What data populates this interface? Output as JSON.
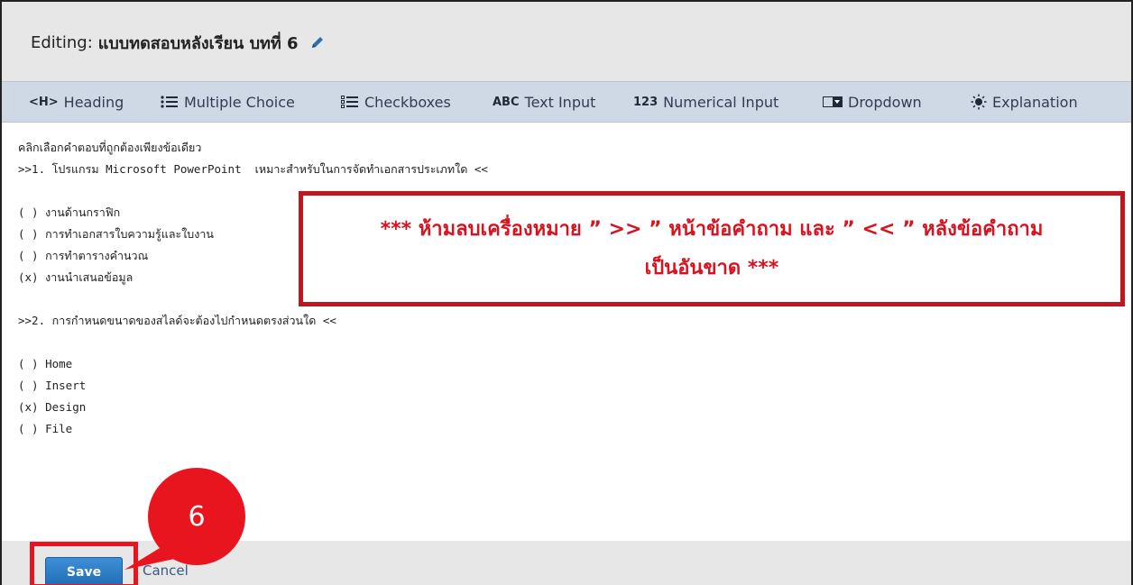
{
  "header": {
    "prefix": "Editing:",
    "title": "แบบทดสอบหลังเรียน บทที่ 6"
  },
  "toolbar": {
    "items": [
      {
        "icon": "<H>",
        "label": "Heading"
      },
      {
        "icon": "list-icon",
        "label": "Multiple Choice"
      },
      {
        "icon": "checklist-icon",
        "label": "Checkboxes"
      },
      {
        "icon": "ABC",
        "label": "Text Input"
      },
      {
        "icon": "123",
        "label": "Numerical Input"
      },
      {
        "icon": "dropdown-icon",
        "label": "Dropdown"
      },
      {
        "icon": "sun-icon",
        "label": "Explanation"
      }
    ]
  },
  "editor": {
    "lines": [
      "คลิกเลือกคำตอบที่ถูกต้องเพียงข้อเดียว",
      ">>1. โปรแกรม Microsoft PowerPoint  เหมาะสำหรับในการจัดทำเอกสารประเภทใด <<",
      "",
      "( ) งานด้านกราฟิก",
      "( ) การทำเอกสารใบความรู้และใบงาน",
      "( ) การทำตารางคำนวณ",
      "(x) งานนำเสนอข้อมูล",
      "",
      ">>2. การกำหนดขนาดของสไลด์จะต้องไปกำหนดตรงส่วนใด <<",
      "",
      "( ) Home",
      "( ) Insert",
      "(x) Design",
      "( ) File"
    ]
  },
  "warning": {
    "line1": "*** ห้ามลบเครื่องหมาย ” >> ” หน้าข้อคำถาม และ ” << ” หลังข้อคำถาม",
    "line2": "เป็นอันขาด ***"
  },
  "footer": {
    "save_label": "Save",
    "cancel_label": "Cancel"
  },
  "annotation": {
    "step_number": "6"
  },
  "colors": {
    "accent_red": "#e9151e",
    "save_blue": "#2a7cc7",
    "toolbar_bg": "#cfd8e5"
  }
}
